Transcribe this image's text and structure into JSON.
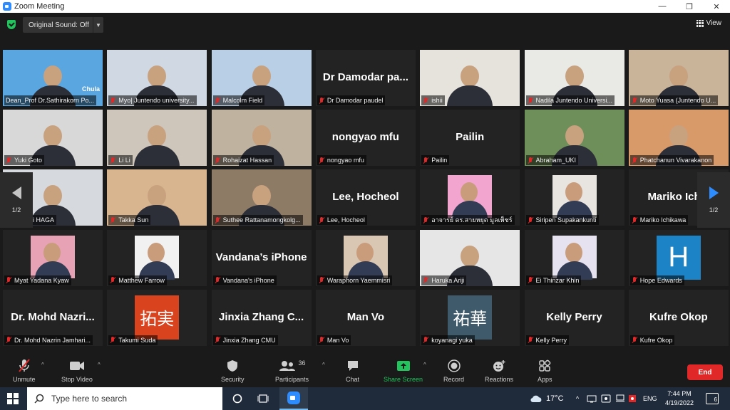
{
  "window": {
    "title": "Zoom Meeting",
    "min": "—",
    "max": "❐",
    "close": "✕"
  },
  "topbar": {
    "sound_label": "Original Sound: Off",
    "view_label": "View"
  },
  "gallery": {
    "page_indicator": "1/2",
    "tiles": [
      {
        "label": "Dean_Prof Dr.Sathirakorn Po...",
        "big": "",
        "video": true,
        "bg": "#5aa6e0",
        "overlay": "Chula"
      },
      {
        "label": "Myo| Juntendo university...",
        "big": "",
        "video": true,
        "bg": "#cfd8e3"
      },
      {
        "label": "Malcolm Field",
        "big": "",
        "video": true,
        "bg": "#b9cfe6"
      },
      {
        "label": "Dr Damodar paudel",
        "big": "Dr Damodar pa...",
        "video": false
      },
      {
        "label": "ishii",
        "big": "",
        "video": true,
        "bg": "#e6e2dc"
      },
      {
        "label": "Nadila Juntendo Universi...",
        "big": "",
        "video": true,
        "bg": "#e9e9e5"
      },
      {
        "label": "Moto Yuasa (Juntendo U...",
        "big": "",
        "video": true,
        "bg": "#c9b49a"
      },
      {
        "label": "Yuki Goto",
        "big": "",
        "video": true,
        "bg": "#d8d8d8"
      },
      {
        "label": "Li Li",
        "big": "",
        "video": true,
        "bg": "#cfc6bb"
      },
      {
        "label": "Rohaizat Hassan",
        "big": "",
        "video": true,
        "bg": "#bfb29e"
      },
      {
        "label": "nongyao mfu",
        "big": "nongyao mfu",
        "video": false
      },
      {
        "label": "Pailin",
        "big": "Pailin",
        "video": false
      },
      {
        "label": "Abraham_UKI",
        "big": "",
        "video": true,
        "bg": "#6f8f5a"
      },
      {
        "label": "Phatchanun Vivarakanon",
        "big": "",
        "video": true,
        "bg": "#d99a6a"
      },
      {
        "label": "Chiyori HAGA",
        "big": "",
        "video": true,
        "bg": "#d6d9de"
      },
      {
        "label": "Takka Sun",
        "big": "",
        "video": true,
        "bg": "#d8b48f"
      },
      {
        "label": "Suthee Rattanamongkolg...",
        "big": "",
        "video": true,
        "bg": "#8d7b66"
      },
      {
        "label": "Lee, Hocheol",
        "big": "Lee, Hocheol",
        "video": false
      },
      {
        "label": "อาจารย์ ดร.สายหยุด มูลเพ็ชร์",
        "big": "",
        "video": true,
        "bg": "#232323",
        "photo": "#f2a6cf"
      },
      {
        "label": "Siripen Supakankunti",
        "big": "",
        "video": true,
        "bg": "#232323",
        "photo": "#e8e4df"
      },
      {
        "label": "Mariko Ichikawa",
        "big": "Mariko Ichik",
        "video": false
      },
      {
        "label": "Myat Yadana Kyaw",
        "big": "",
        "video": true,
        "bg": "#232323",
        "photo": "#e7a3b5"
      },
      {
        "label": "Matthew Farrow",
        "big": "",
        "video": true,
        "bg": "#232323",
        "photo": "#f1f1f1"
      },
      {
        "label": "Vandana's iPhone",
        "big": "Vandana’s iPhone",
        "video": false
      },
      {
        "label": "Waraphorn Yaemmisri",
        "big": "",
        "video": true,
        "bg": "#232323",
        "photo": "#d9c7b4"
      },
      {
        "label": "Haruka Ariji",
        "big": "",
        "video": true,
        "bg": "#e6e6e6"
      },
      {
        "label": "Ei Thinzar Khin",
        "big": "",
        "video": true,
        "bg": "#232323",
        "photo": "#e6e2ef"
      },
      {
        "label": "Hope Edwards",
        "big": "",
        "video": false,
        "letter": "H"
      },
      {
        "label": "Dr. Mohd Nazrin Jamhari...",
        "big": "Dr. Mohd Nazri...",
        "video": false
      },
      {
        "label": "Takumi Suda",
        "big": "",
        "video": false,
        "cjk": "拓実",
        "cjk_bg": "#d9431e"
      },
      {
        "label": "Jinxia Zhang CMU",
        "big": "Jinxia Zhang C...",
        "video": false
      },
      {
        "label": "Man Vo",
        "big": "Man Vo",
        "video": false
      },
      {
        "label": "koyanagi yuka",
        "big": "",
        "video": false,
        "cjk": "祐華",
        "cjk_bg": "#3f5a6a"
      },
      {
        "label": "Kelly Perry",
        "big": "Kelly Perry",
        "video": false
      },
      {
        "label": "Kufre Okop",
        "big": "Kufre Okop",
        "video": false
      }
    ]
  },
  "toolbar": {
    "unmute": "Unmute",
    "stop_video": "Stop Video",
    "security": "Security",
    "participants": "Participants",
    "participants_count": "36",
    "chat": "Chat",
    "share_screen": "Share Screen",
    "record": "Record",
    "reactions": "Reactions",
    "apps": "Apps",
    "end": "End"
  },
  "taskbar": {
    "search_placeholder": "Type here to search",
    "temperature": "17°C",
    "language": "ENG",
    "time": "7:44 PM",
    "date": "4/19/2022",
    "notifications": "6"
  },
  "colors": {
    "accent": "#2d8cff",
    "share": "#21c45d",
    "end": "#e02828",
    "active_speaker": "#f8e71c"
  }
}
